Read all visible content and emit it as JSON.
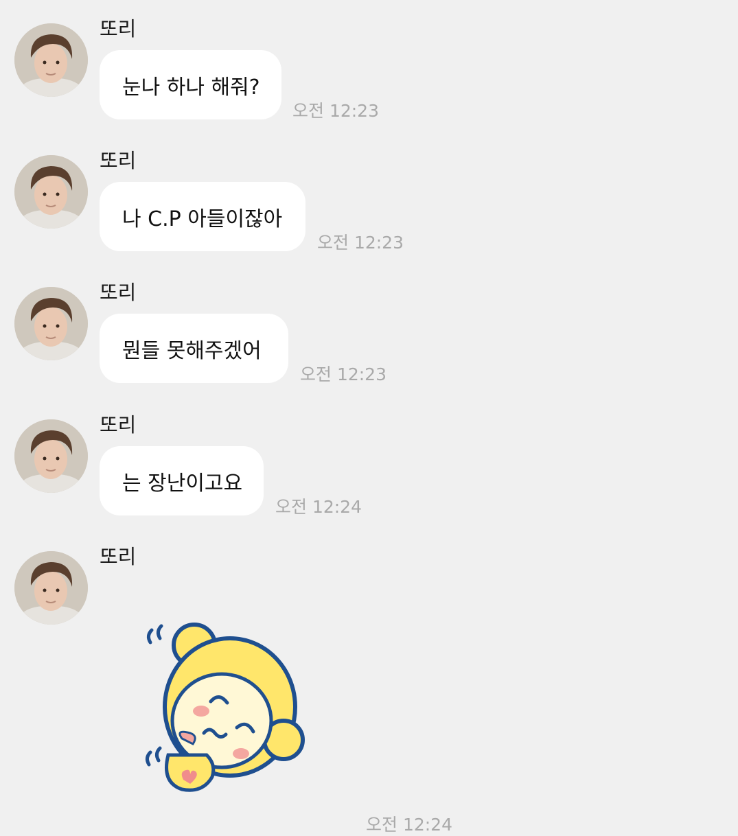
{
  "chat": {
    "messages": [
      {
        "sender": "또리",
        "text": "눈나 하나 해줘?",
        "time": "오전 12:23"
      },
      {
        "sender": "또리",
        "text": "나 C.P 아들이잖아",
        "time": "오전 12:23"
      },
      {
        "sender": "또리",
        "text": "뭔들 못해주겠어",
        "time": "오전 12:23"
      },
      {
        "sender": "또리",
        "text": "는 장난이고요",
        "time": "오전 12:24"
      }
    ],
    "sticker_message": {
      "sender": "또리",
      "sticker": "sleeping-yellow-character-sticker",
      "time": "오전 12:24"
    }
  },
  "colors": {
    "background": "#f0f0f0",
    "bubble": "#ffffff",
    "time_text": "#a9a9a9",
    "sticker_yellow": "#ffe66b",
    "sticker_outline": "#1f4f8f"
  }
}
